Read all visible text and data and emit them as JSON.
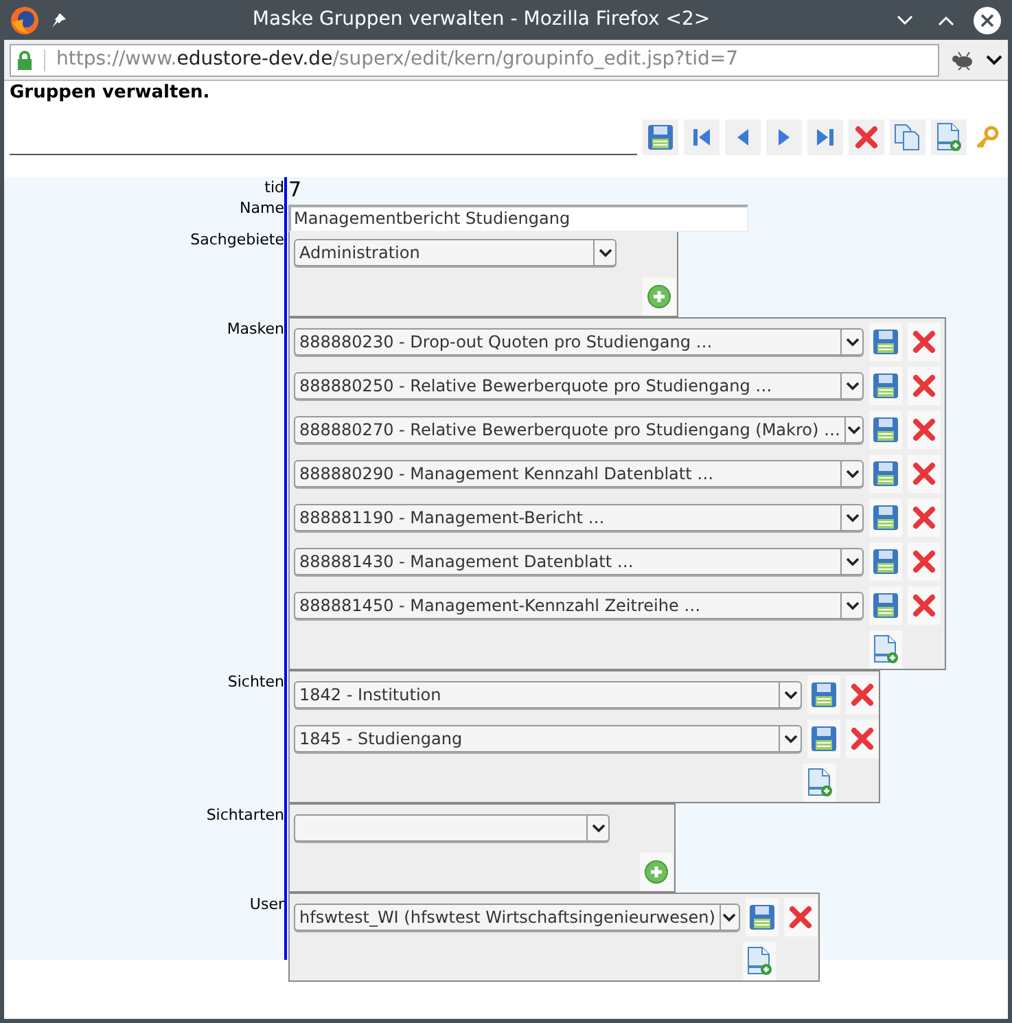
{
  "window": {
    "title": "Maske Gruppen verwalten - Mozilla Firefox <2>"
  },
  "url": {
    "prefix": "https://www.",
    "domain": "edustore-dev.de",
    "path": "/superx/edit/kern/groupinfo_edit.jsp?tid=7"
  },
  "heading": "Gruppen verwalten.",
  "form": [
    {
      "label": "tid",
      "kind": "text",
      "value": "7"
    },
    {
      "label": "Name",
      "kind": "input",
      "value": "Managementbericht Studiengang"
    },
    {
      "label": "Sachgebiete",
      "kind": "list",
      "row_buttons": false,
      "add_button": {
        "kind": "plus"
      },
      "items": [
        "Administration"
      ]
    },
    {
      "label": "Masken",
      "kind": "list",
      "row_buttons": true,
      "add_button": {
        "kind": "new"
      },
      "items": [
        "888880230 - Drop-out Quoten pro Studiengang …",
        "888880250 - Relative Bewerberquote pro Studiengang …",
        "888880270 - Relative Bewerberquote pro Studiengang (Makro) …",
        "888880290 - Management Kennzahl Datenblatt …",
        "888881190 - Management-Bericht …",
        "888881430 - Management Datenblatt …",
        "888881450 - Management-Kennzahl Zeitreihe …"
      ]
    },
    {
      "label": "Sichten",
      "kind": "list",
      "row_buttons": true,
      "add_button": {
        "kind": "new"
      },
      "items": [
        "1842 - Institution",
        "1845 - Studiengang"
      ]
    },
    {
      "label": "Sichtarten",
      "kind": "list",
      "row_buttons": false,
      "add_button": {
        "kind": "plus"
      }
    },
    {
      "label": "User",
      "kind": "list",
      "row_buttons": true,
      "add_button": {
        "kind": "new"
      },
      "items": [
        "hfswtest_WI (hfswtest Wirtschaftsingenieurwesen)"
      ]
    }
  ]
}
